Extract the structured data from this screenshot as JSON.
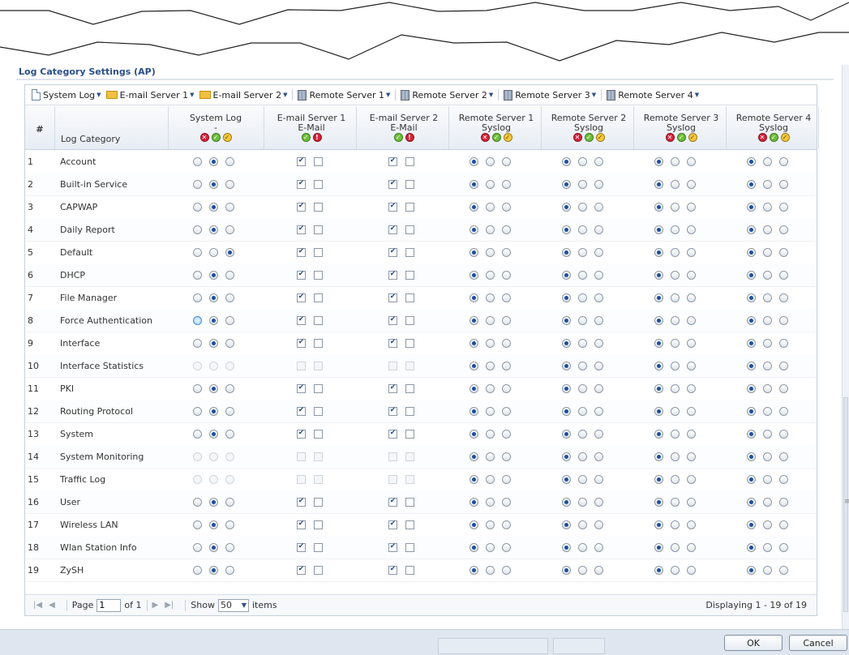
{
  "section_title": "Log Category Settings (AP)",
  "toolbar": {
    "items": [
      "System Log",
      "E-mail Server 1",
      "E-mail Server 2",
      "Remote Server 1",
      "Remote Server 2",
      "Remote Server 3",
      "Remote Server 4"
    ]
  },
  "table": {
    "col_num": "#",
    "col_category": "Log Category",
    "columns": [
      {
        "title": "System Log",
        "sub": "-",
        "icons": [
          "disable-icon",
          "normal-icon",
          "debug-icon"
        ]
      },
      {
        "title": "E-mail Server 1",
        "sub": "E-Mail",
        "icons": [
          "normal-icon",
          "alert-icon"
        ]
      },
      {
        "title": "E-mail Server 2",
        "sub": "E-Mail",
        "icons": [
          "normal-icon",
          "alert-icon"
        ]
      },
      {
        "title": "Remote Server 1",
        "sub": "Syslog",
        "icons": [
          "disable-icon",
          "normal-icon",
          "debug-icon"
        ]
      },
      {
        "title": "Remote Server 2",
        "sub": "Syslog",
        "icons": [
          "disable-icon",
          "normal-icon",
          "debug-icon"
        ]
      },
      {
        "title": "Remote Server 3",
        "sub": "Syslog",
        "icons": [
          "disable-icon",
          "normal-icon",
          "debug-icon"
        ]
      },
      {
        "title": "Remote Server 4",
        "sub": "Syslog",
        "icons": [
          "disable-icon",
          "normal-icon",
          "debug-icon"
        ]
      }
    ],
    "rows": [
      {
        "num": "1",
        "category": "Account",
        "syslog": 1,
        "email1": [
          1,
          0
        ],
        "email2": [
          1,
          0
        ]
      },
      {
        "num": "2",
        "category": "Built-in Service",
        "syslog": 1,
        "email1": [
          1,
          0
        ],
        "email2": [
          1,
          0
        ]
      },
      {
        "num": "3",
        "category": "CAPWAP",
        "syslog": 1,
        "email1": [
          1,
          0
        ],
        "email2": [
          1,
          0
        ]
      },
      {
        "num": "4",
        "category": "Daily Report",
        "syslog": 1,
        "email1": [
          1,
          0
        ],
        "email2": [
          1,
          0
        ]
      },
      {
        "num": "5",
        "category": "Default",
        "syslog": 2,
        "email1": [
          1,
          0
        ],
        "email2": [
          1,
          0
        ]
      },
      {
        "num": "6",
        "category": "DHCP",
        "syslog": 1,
        "email1": [
          1,
          0
        ],
        "email2": [
          1,
          0
        ]
      },
      {
        "num": "7",
        "category": "File Manager",
        "syslog": 1,
        "email1": [
          1,
          0
        ],
        "email2": [
          1,
          0
        ]
      },
      {
        "num": "8",
        "category": "Force Authentication",
        "syslog": 1,
        "email1": [
          1,
          0
        ],
        "email2": [
          1,
          0
        ],
        "hover": 0
      },
      {
        "num": "9",
        "category": "Interface",
        "syslog": 1,
        "email1": [
          1,
          0
        ],
        "email2": [
          1,
          0
        ]
      },
      {
        "num": "10",
        "category": "Interface Statistics",
        "syslog": -1,
        "email1": [
          -1,
          -1
        ],
        "email2": [
          -1,
          -1
        ]
      },
      {
        "num": "11",
        "category": "PKI",
        "syslog": 1,
        "email1": [
          1,
          0
        ],
        "email2": [
          1,
          0
        ]
      },
      {
        "num": "12",
        "category": "Routing Protocol",
        "syslog": 1,
        "email1": [
          1,
          0
        ],
        "email2": [
          1,
          0
        ]
      },
      {
        "num": "13",
        "category": "System",
        "syslog": 1,
        "email1": [
          1,
          0
        ],
        "email2": [
          1,
          0
        ]
      },
      {
        "num": "14",
        "category": "System Monitoring",
        "syslog": -1,
        "email1": [
          -1,
          -1
        ],
        "email2": [
          -1,
          -1
        ]
      },
      {
        "num": "15",
        "category": "Traffic Log",
        "syslog": -1,
        "email1": [
          -1,
          -1
        ],
        "email2": [
          -1,
          -1
        ]
      },
      {
        "num": "16",
        "category": "User",
        "syslog": 1,
        "email1": [
          1,
          0
        ],
        "email2": [
          1,
          0
        ]
      },
      {
        "num": "17",
        "category": "Wireless LAN",
        "syslog": 1,
        "email1": [
          1,
          0
        ],
        "email2": [
          1,
          0
        ]
      },
      {
        "num": "18",
        "category": "Wlan Station Info",
        "syslog": 1,
        "email1": [
          1,
          0
        ],
        "email2": [
          1,
          0
        ]
      },
      {
        "num": "19",
        "category": "ZySH",
        "syslog": 1,
        "email1": [
          1,
          0
        ],
        "email2": [
          1,
          0
        ]
      }
    ],
    "remote_selected": 0
  },
  "pager": {
    "page_label": "Page",
    "page_value": "1",
    "of_label": "of 1",
    "show_label": "Show",
    "show_value": "50",
    "items_label": "items",
    "displaying": "Displaying 1 - 19 of 19"
  },
  "footer": {
    "ok_label": "OK",
    "cancel_label": "Cancel"
  }
}
